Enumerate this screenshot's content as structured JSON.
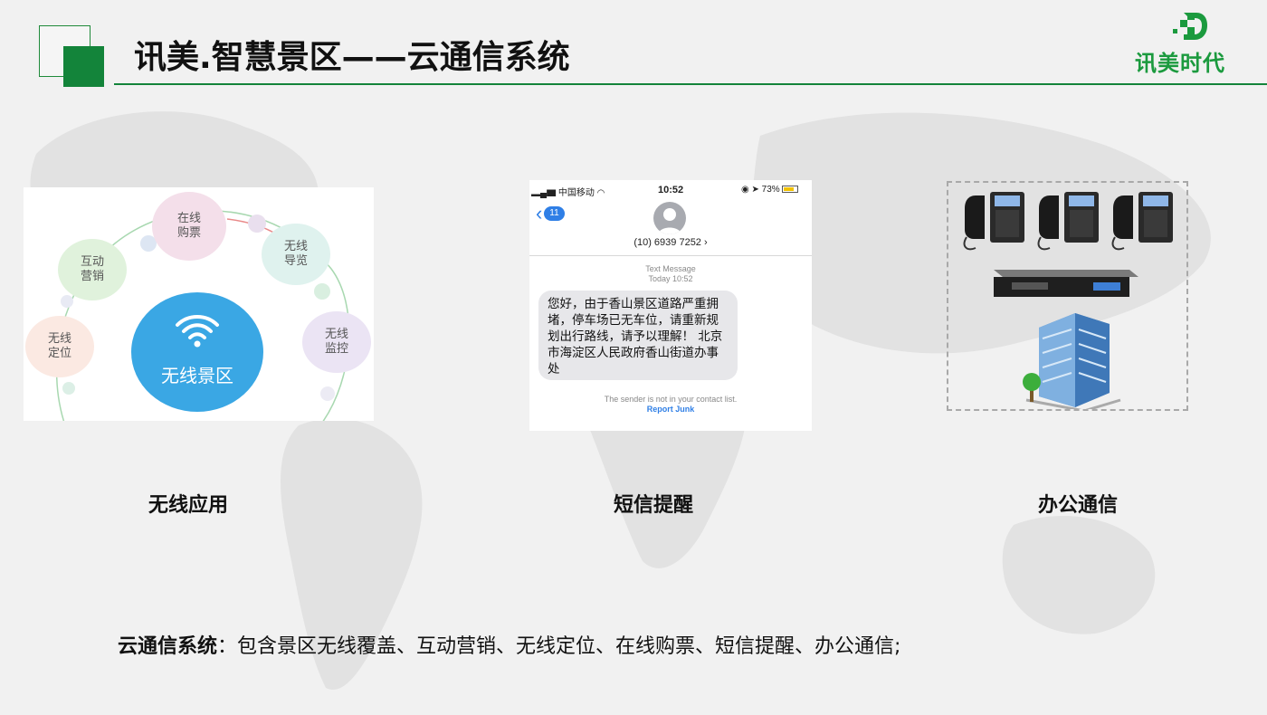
{
  "header": {
    "title": "讯美.智慧景区——云通信系统",
    "logo_text": "讯美时代"
  },
  "colors": {
    "brand_green": "#13843a",
    "logo_green": "#1b9a3e",
    "wifi_blue": "#3aa7e4",
    "ios_blue": "#2f7fe6"
  },
  "wireless_diagram": {
    "center_label": "无线景区",
    "bubbles": [
      {
        "label": "在线\n购票"
      },
      {
        "label": "互动\n营销"
      },
      {
        "label": "无线\n导览"
      },
      {
        "label": "无线\n定位"
      },
      {
        "label": "无线\n监控"
      }
    ]
  },
  "phone": {
    "carrier": "中国移动",
    "time": "10:52",
    "battery": "73%",
    "back_count": "11",
    "contact_number": "(10) 6939 7252",
    "meta_line1": "Text Message",
    "meta_line2": "Today 10:52",
    "message": "您好，由于香山景区道路严重拥堵，停车场已无车位，请重新规划出行路线，请予以理解！ 北京市海淀区人民政府香山街道办事处",
    "not_contact": "The sender is not in your contact list.",
    "report_junk": "Report Junk"
  },
  "captions": {
    "wireless": "无线应用",
    "sms": "短信提醒",
    "office": "办公通信"
  },
  "summary": {
    "label": "云通信系统",
    "text": "：包含景区无线覆盖、互动营销、无线定位、在线购票、短信提醒、办公通信;"
  }
}
